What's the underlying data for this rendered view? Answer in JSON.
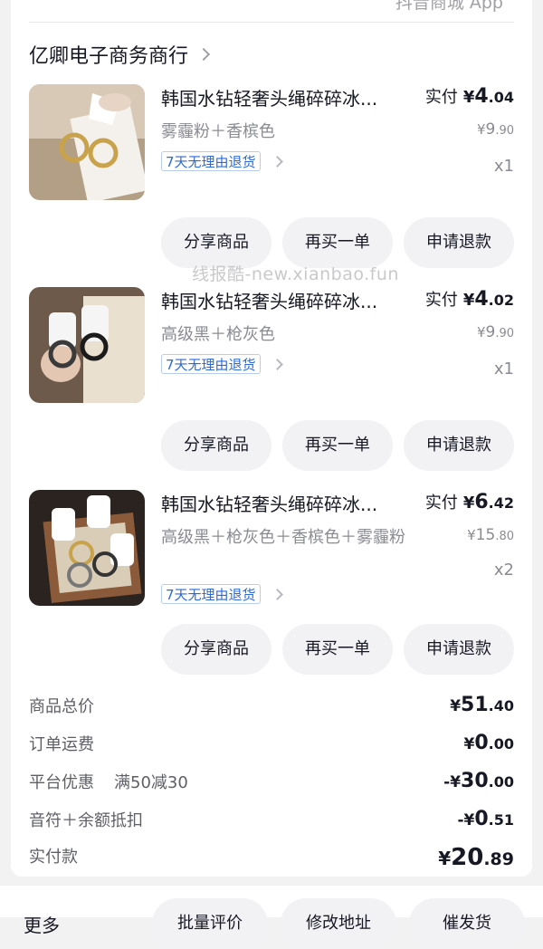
{
  "header": {
    "app_tip": "抖音商城 App"
  },
  "shop": {
    "name": "亿卿电子商务商行"
  },
  "watermark": "线报酷-new.xianbao.fun",
  "items": [
    {
      "title": "韩国水钻轻奢头绳碎碎冰...",
      "spec": "雾霾粉＋香槟色",
      "badge": "7天无理由退货",
      "paid_label": "实付",
      "paid_yen": "¥",
      "paid_int": "4",
      "paid_dec": ".04",
      "orig_yen": "¥",
      "orig_int": "9",
      "orig_dec": ".90",
      "qty": "x1",
      "buttons": [
        "分享商品",
        "再买一单",
        "申请退款"
      ]
    },
    {
      "title": "韩国水钻轻奢头绳碎碎冰...",
      "spec": "高级黑＋枪灰色",
      "badge": "7天无理由退货",
      "paid_label": "实付",
      "paid_yen": "¥",
      "paid_int": "4",
      "paid_dec": ".02",
      "orig_yen": "¥",
      "orig_int": "9",
      "orig_dec": ".90",
      "qty": "x1",
      "buttons": [
        "分享商品",
        "再买一单",
        "申请退款"
      ]
    },
    {
      "title": "韩国水钻轻奢头绳碎碎冰...",
      "spec": "高级黑＋枪灰色＋香槟色＋雾霾粉",
      "badge": "7天无理由退货",
      "paid_label": "实付",
      "paid_yen": "¥",
      "paid_int": "6",
      "paid_dec": ".42",
      "orig_yen": "¥",
      "orig_int": "15",
      "orig_dec": ".80",
      "qty": "x2",
      "buttons": [
        "分享商品",
        "再买一单",
        "申请退款"
      ]
    }
  ],
  "summary": {
    "goods_total": {
      "label": "商品总价",
      "yen": "¥",
      "int": "51",
      "dec": ".40"
    },
    "shipping": {
      "label": "订单运费",
      "yen": "¥",
      "int": "0",
      "dec": ".00"
    },
    "platform_discount": {
      "label": "平台优惠",
      "promo": "满50减30",
      "yen": "-¥",
      "int": "30",
      "dec": ".00"
    },
    "yinfu_deduction": {
      "label": "音符＋余额抵扣",
      "yen": "-¥",
      "int": "0",
      "dec": ".51"
    },
    "paid_total": {
      "label": "实付款",
      "yen": "¥",
      "int": "20",
      "dec": ".89"
    }
  },
  "bottom_bar": {
    "more_label": "更多",
    "buttons": [
      "批量评价",
      "修改地址",
      "催发货"
    ]
  }
}
